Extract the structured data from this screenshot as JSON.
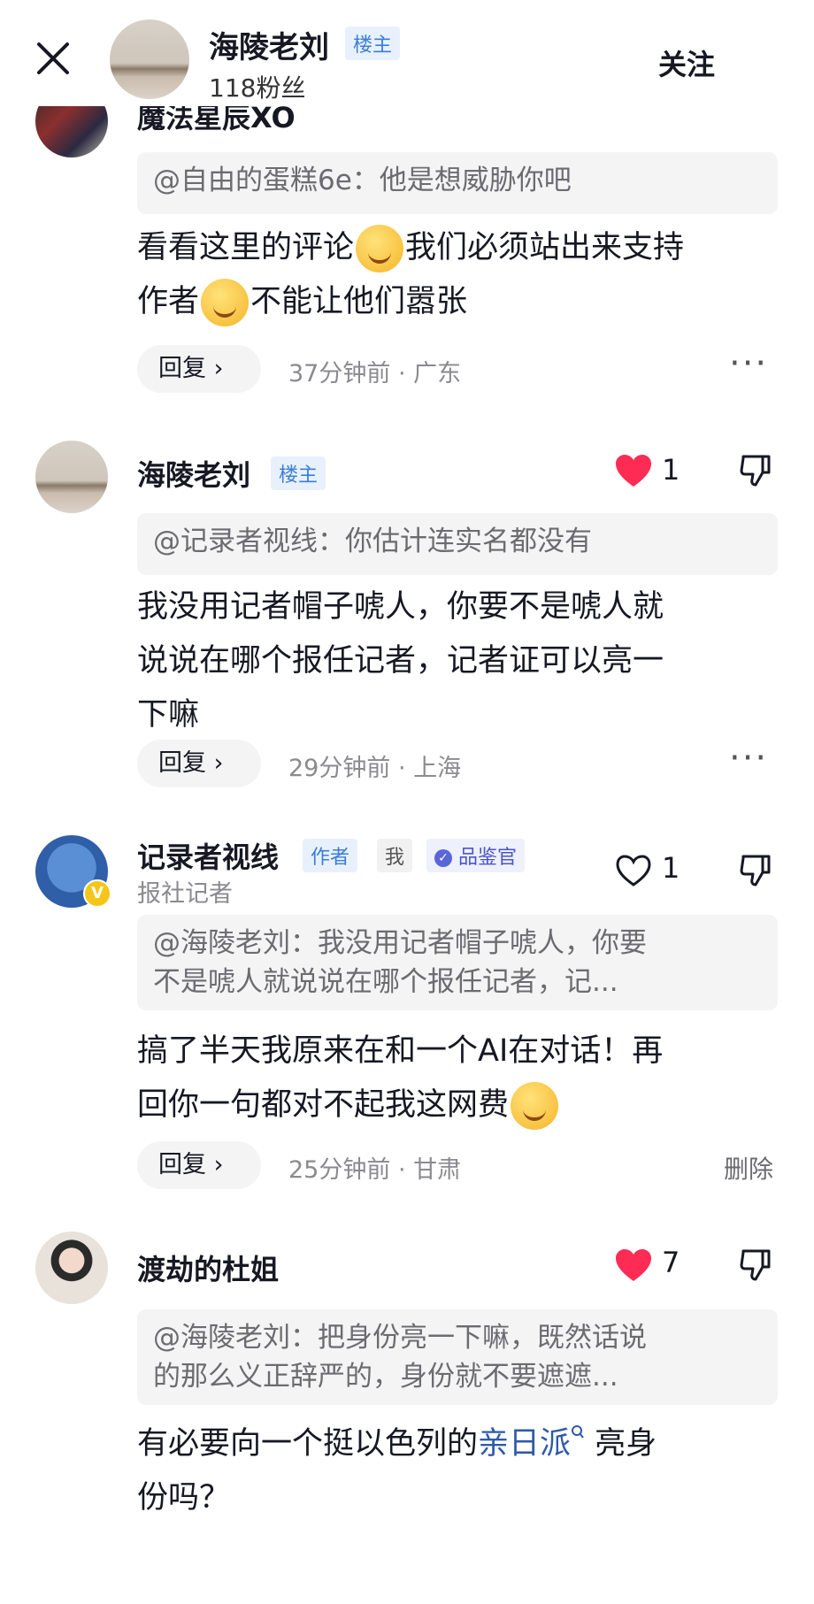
{
  "header": {
    "author_name": "海陵老刘",
    "author_badge": "楼主",
    "fans": "118粉丝",
    "follow_label": "关注"
  },
  "comments": [
    {
      "name": "魔法星辰XO",
      "quote": "@自由的蛋糕6e：他是想威胁你吧",
      "body_1": "看看这里的评论",
      "body_2": "我们必须站出来支持",
      "body_3": "作者",
      "body_4": "不能让他们嚣张",
      "emoji_1": "laughing-crying-emoji",
      "emoji_2": "thinking-emoji",
      "reply_label": "回复 ›",
      "time": "37分钟前",
      "location": "广东",
      "more": "···"
    },
    {
      "name": "海陵老刘",
      "badge": "楼主",
      "likes": "1",
      "liked": true,
      "quote": "@记录者视线：你估计连实名都没有",
      "body_line_1": "我没用记者帽子唬人，你要不是唬人就",
      "body_line_2": "说说在哪个报任记者，记者证可以亮一",
      "body_line_3": "下嘛",
      "reply_label": "回复 ›",
      "time": "29分钟前",
      "location": "上海",
      "more": "···"
    },
    {
      "name": "记录者视线",
      "badge": "作者",
      "me_badge": "我",
      "taster_badge": "品鉴官",
      "role": "报社记者",
      "likes": "1",
      "liked": false,
      "quote_line_1": "@海陵老刘：我没用记者帽子唬人，你要",
      "quote_line_2": "不是唬人就说说在哪个报任记者，记...",
      "body_line_1": "搞了半天我原来在和一个AI在对话！再",
      "body_line_2": "回你一句都对不起我这网费",
      "emoji": "smirk-emoji",
      "reply_label": "回复 ›",
      "time": "25分钟前",
      "location": "甘肃",
      "delete_label": "删除"
    },
    {
      "name": "渡劫的杜姐",
      "likes": "7",
      "liked": true,
      "quote_line_1": "@海陵老刘：把身份亮一下嘛，既然话说",
      "quote_line_2": "的那么义正辞严的，身份就不要遮遮...",
      "body_pre": "有必要向一个挺以色列的",
      "body_link": "亲日派",
      "body_post": " 亮身",
      "body_line_2": "份吗？"
    }
  ],
  "colors": {
    "like_red": "#fe2c55",
    "badge_bg": "#e8f1fb",
    "badge_text": "#3b7dd8",
    "link": "#2e5aa8",
    "quote_bg": "#f4f4f5"
  }
}
